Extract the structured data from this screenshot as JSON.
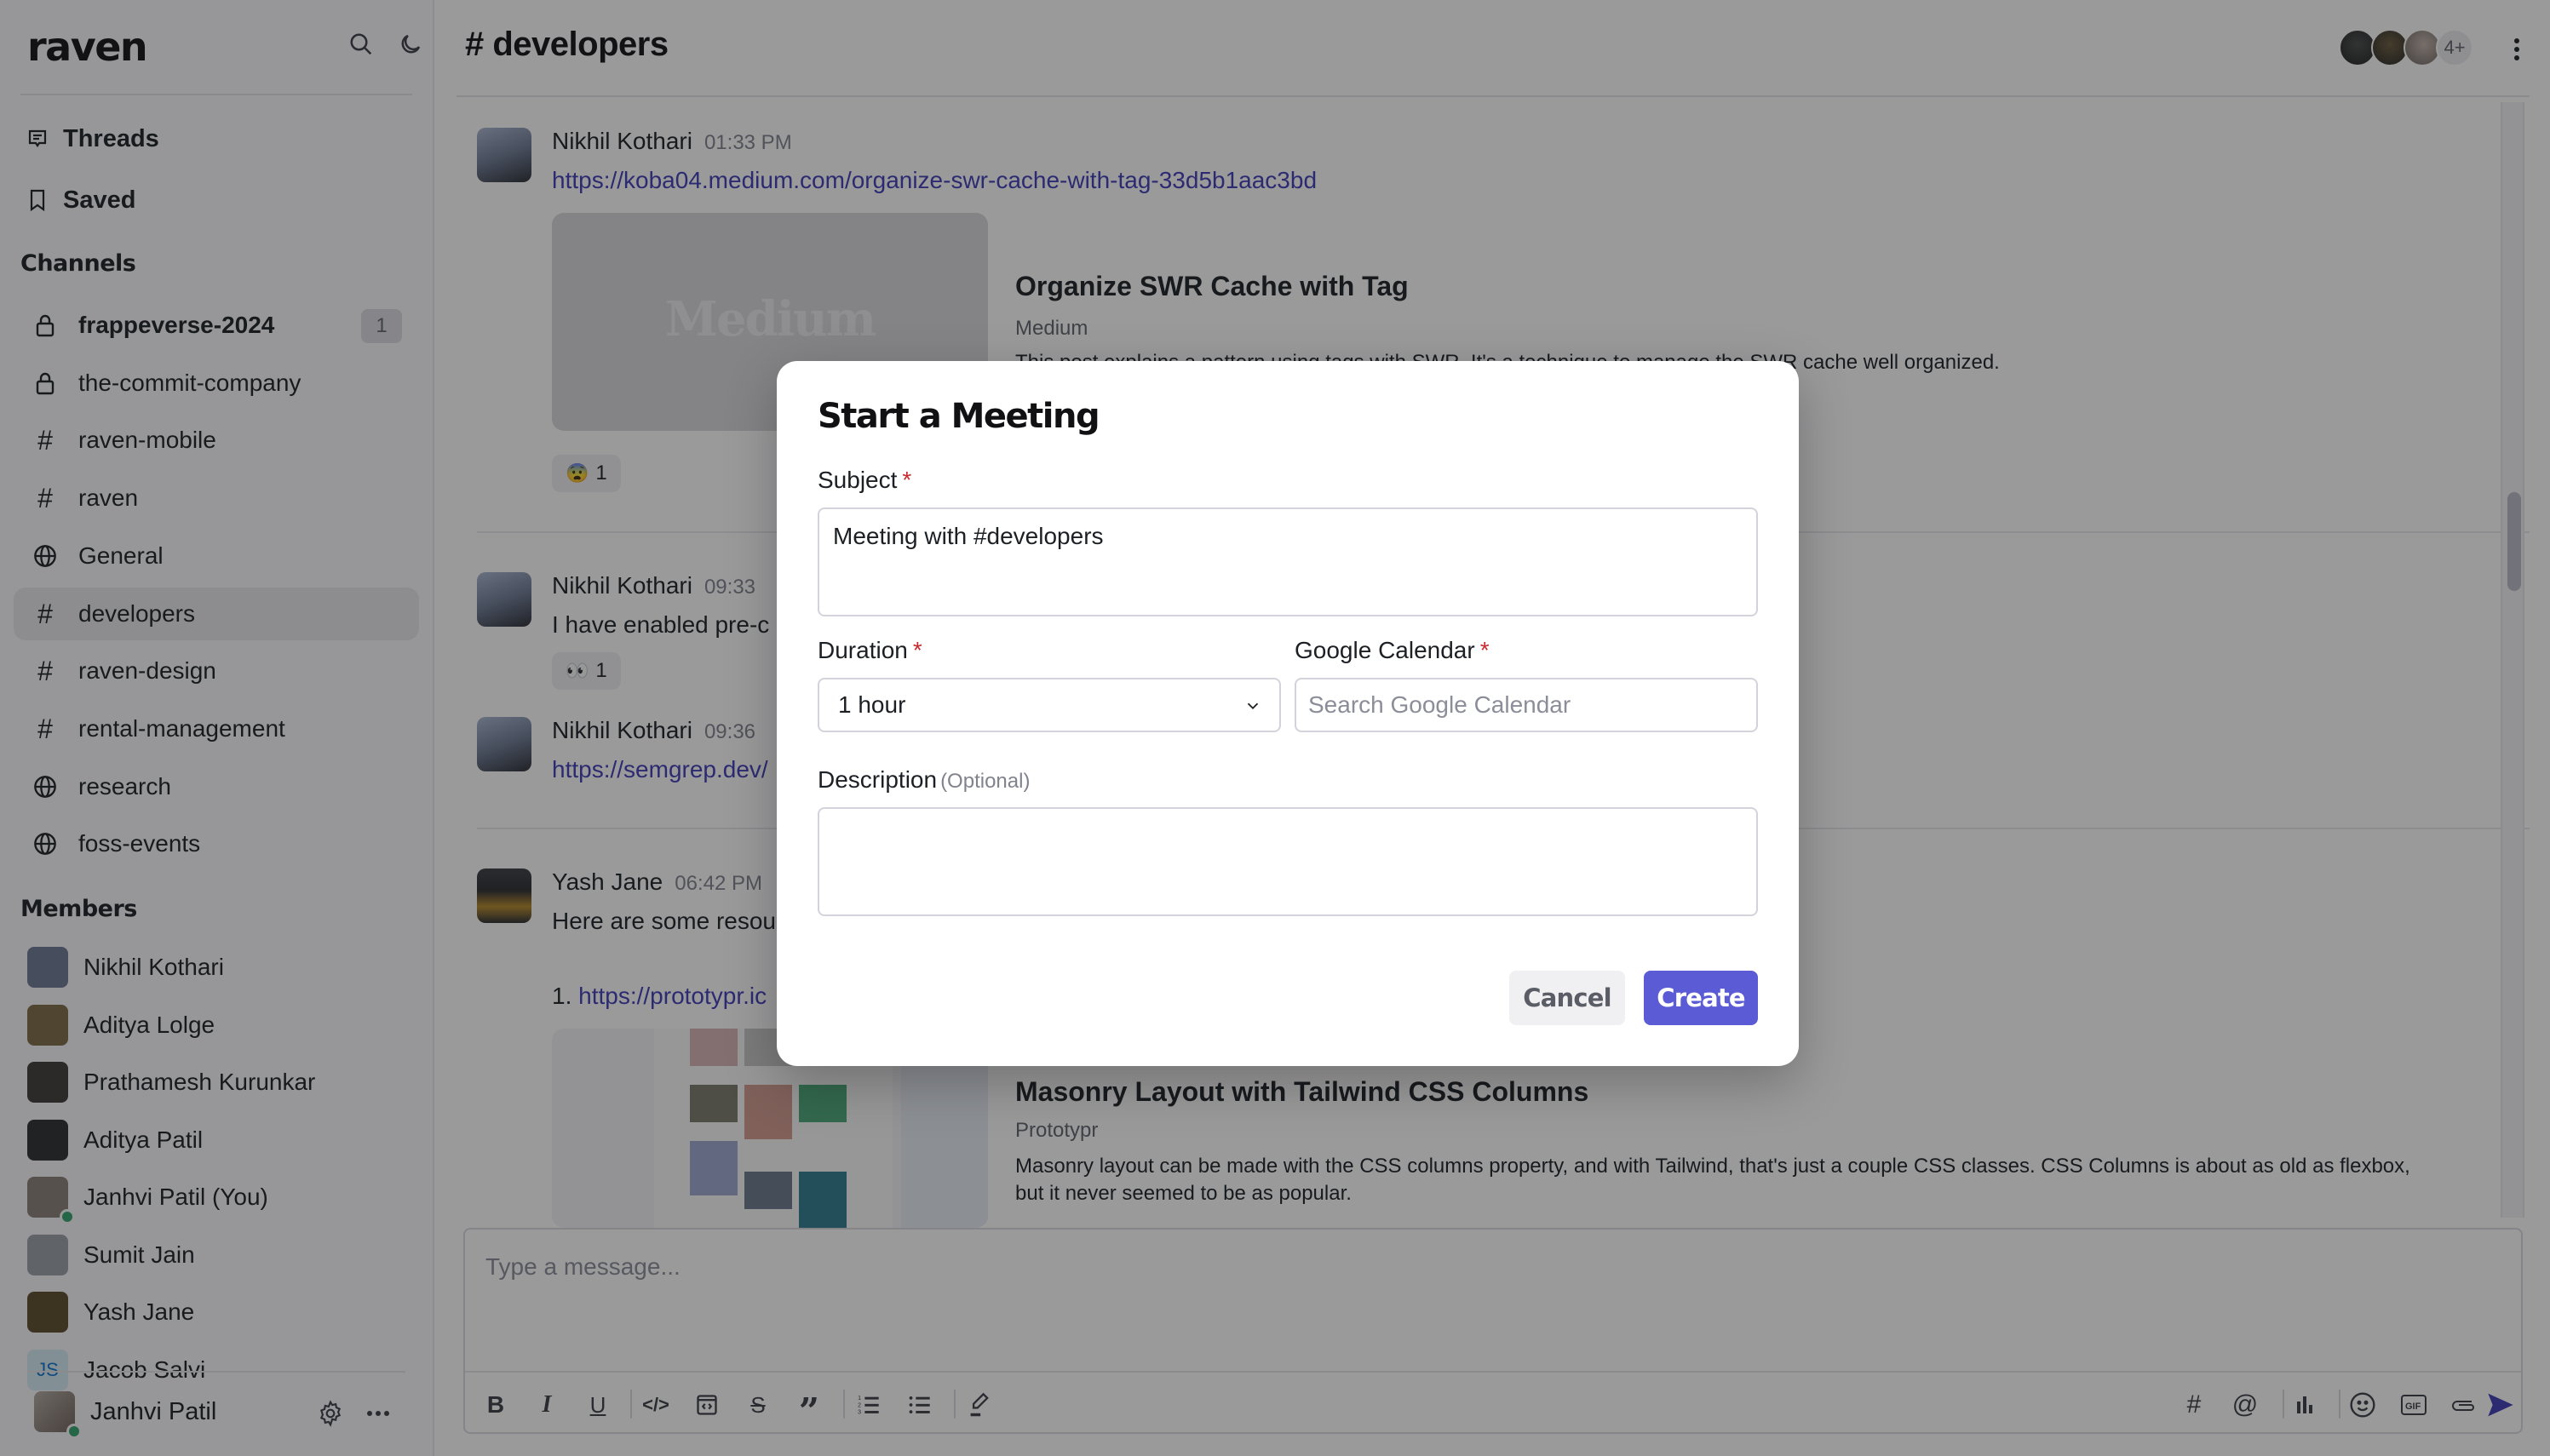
{
  "sidebar": {
    "logo": "raven",
    "nav": [
      {
        "label": "Threads",
        "icon": "threads-icon"
      },
      {
        "label": "Saved",
        "icon": "bookmark-icon"
      }
    ],
    "channels_title": "Channels",
    "channels": [
      {
        "name": "frappeverse-2024",
        "type": "private",
        "unread": "1"
      },
      {
        "name": "the-commit-company",
        "type": "private"
      },
      {
        "name": "raven-mobile",
        "type": "public"
      },
      {
        "name": "raven",
        "type": "public"
      },
      {
        "name": "General",
        "type": "open"
      },
      {
        "name": "developers",
        "type": "public",
        "active": true
      },
      {
        "name": "raven-design",
        "type": "public"
      },
      {
        "name": "rental-management",
        "type": "public"
      },
      {
        "name": "research",
        "type": "open"
      },
      {
        "name": "foss-events",
        "type": "open"
      }
    ],
    "members_title": "Members",
    "members": [
      {
        "name": "Nikhil Kothari",
        "color": "#6b7a93"
      },
      {
        "name": "Aditya Lolge",
        "color": "#7b6a44"
      },
      {
        "name": "Prathamesh Kurunkar",
        "color": "#3d3a37"
      },
      {
        "name": "Aditya Patil",
        "color": "#2a2c2c"
      },
      {
        "name": "Janhvi Patil (You)",
        "color": "#8a7f78",
        "online": true
      },
      {
        "name": "Sumit Jain",
        "color": "#9aa1a8"
      },
      {
        "name": "Yash Jane",
        "color": "#5a4b2a"
      },
      {
        "name": "Jacob Salvi",
        "initials": "JS",
        "color": "#d5ecf4"
      }
    ],
    "current_user": {
      "name": "Janhvi Patil",
      "online": true
    }
  },
  "channel": {
    "title": "# developers",
    "members_more": "4+"
  },
  "messages": [
    {
      "author": "Nikhil Kothari",
      "time": "01:33 PM",
      "link": "https://koba04.medium.com/organize-swr-cache-with-tag-33d5b1aac3bd",
      "preview": {
        "image_text": "Medium",
        "title": "Organize SWR Cache with Tag",
        "site": "Medium",
        "description": "This post explains a pattern using tags with SWR. It's a technique to manage the SWR cache well organized."
      },
      "reaction": {
        "emoji": "😨",
        "count": "1"
      }
    },
    {
      "author": "Nikhil Kothari",
      "time": "09:33",
      "text": "I have enabled pre-c",
      "reaction": {
        "emoji": "👀",
        "count": "1"
      }
    },
    {
      "author": "Nikhil Kothari",
      "time": "09:36",
      "link": "https://semgrep.dev/"
    },
    {
      "author": "Yash Jane",
      "time": "06:42 PM",
      "text": "Here are some resou",
      "list_prefix": "1.",
      "link": "https://prototypr.ic",
      "preview": {
        "title": "Masonry Layout with Tailwind CSS Columns",
        "site": "Prototypr",
        "description": "Masonry layout can be made with the CSS columns property, and with Tailwind, that's just a couple CSS classes. CSS Columns is about as old as flexbox, but it never seemed to be as popular."
      }
    }
  ],
  "composer": {
    "placeholder": "Type a message...",
    "toolbar_left": [
      "bold-icon",
      "italic-icon",
      "underline-icon",
      "code-icon",
      "code-block-icon",
      "strikethrough-icon",
      "quote-icon",
      "ordered-list-icon",
      "bullet-list-icon",
      "highlight-icon"
    ],
    "toolbar_right": [
      "channel-mention-icon",
      "user-mention-icon",
      "poll-icon",
      "emoji-icon",
      "gif-icon",
      "attachment-icon",
      "send-icon"
    ]
  },
  "modal": {
    "title": "Start a Meeting",
    "subject_label": "Subject",
    "subject_value": "Meeting with #developers",
    "required_mark": "*",
    "duration_label": "Duration",
    "duration_value": "1 hour",
    "calendar_label": "Google Calendar",
    "calendar_placeholder": "Search Google Calendar",
    "description_label": "Description",
    "description_optional": "(Optional)",
    "description_value": "",
    "cancel_label": "Cancel",
    "create_label": "Create"
  },
  "colors": {
    "accent": "#5b5bd6",
    "link": "#3e3db6",
    "required": "#c62a2f",
    "online": "#30a46c"
  }
}
